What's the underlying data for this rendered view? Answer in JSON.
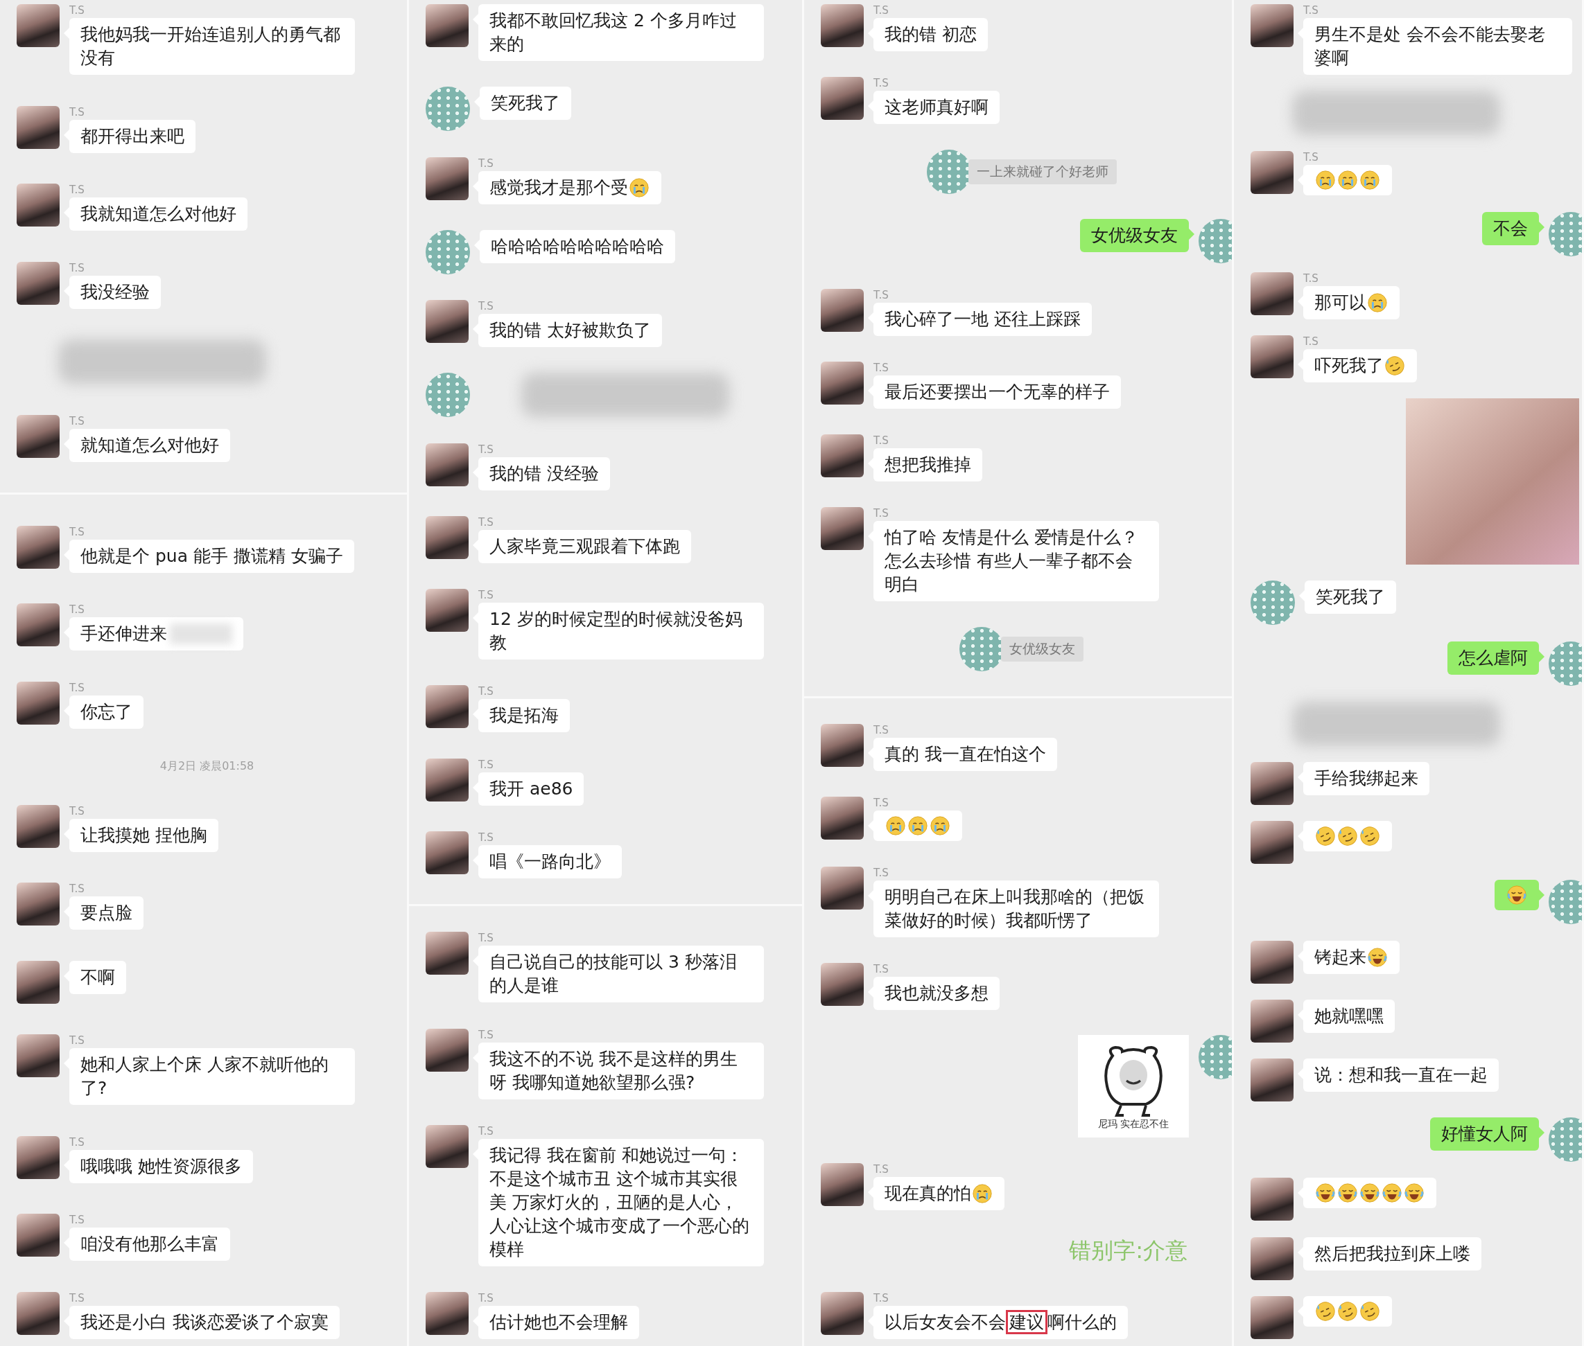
{
  "columns": [
    {
      "messages": [
        {
          "kind": "in",
          "masked_avatar": false,
          "name": "T.S",
          "text": "我他妈我一开始连追别人的勇气都没有"
        },
        {
          "kind": "in",
          "masked_avatar": false,
          "name": "T.S",
          "text": "都开得出来吧"
        },
        {
          "kind": "in",
          "masked_avatar": false,
          "name": "T.S",
          "text": "我就知道怎么对他好"
        },
        {
          "kind": "in",
          "masked_avatar": false,
          "name": "T.S",
          "text": "我没经验"
        },
        {
          "kind": "blur",
          "masked": false
        },
        {
          "kind": "in",
          "masked_avatar": false,
          "name": "T.S",
          "text": "就知道怎么对他好"
        },
        {
          "kind": "divider"
        },
        {
          "kind": "in",
          "masked_avatar": false,
          "name": "T.S",
          "text": "他就是个 pua 能手 撒谎精 女骗子"
        },
        {
          "kind": "in",
          "masked_avatar": false,
          "name": "T.S",
          "text": "手还伸进来",
          "tail_blurred": true
        },
        {
          "kind": "in",
          "masked_avatar": false,
          "name": "T.S",
          "text": "你忘了"
        },
        {
          "kind": "time",
          "text": "4月2日 凌晨01:58"
        },
        {
          "kind": "in",
          "masked_avatar": false,
          "name": "T.S",
          "text": "让我摸她 捏他胸"
        },
        {
          "kind": "in",
          "masked_avatar": false,
          "name": "T.S",
          "text": "要点脸"
        },
        {
          "kind": "in",
          "masked_avatar": false,
          "text": "不啊"
        },
        {
          "kind": "in",
          "masked_avatar": false,
          "name": "T.S",
          "text": "她和人家上个床 人家不就听他的了?"
        },
        {
          "kind": "in",
          "masked_avatar": false,
          "name": "T.S",
          "text": "哦哦哦 她性资源很多"
        },
        {
          "kind": "in",
          "masked_avatar": false,
          "name": "T.S",
          "text": "咱没有他那么丰富"
        },
        {
          "kind": "in",
          "masked_avatar": false,
          "name": "T.S",
          "text": "我还是小白 我谈恋爱谈了个寂寞"
        }
      ]
    },
    {
      "messages": [
        {
          "kind": "in",
          "masked_avatar": false,
          "text": "我都不敢回忆我这 2 个多月咋过来的"
        },
        {
          "kind": "in",
          "masked_avatar": true,
          "text": "笑死我了"
        },
        {
          "kind": "in",
          "masked_avatar": false,
          "name": "T.S",
          "text": "感觉我才是那个受",
          "emojis": [
            {
              "kind": "cry"
            }
          ]
        },
        {
          "kind": "in",
          "masked_avatar": true,
          "text": "哈哈哈哈哈哈哈哈哈哈"
        },
        {
          "kind": "in",
          "masked_avatar": false,
          "name": "T.S",
          "text": "我的错 太好被欺负了"
        },
        {
          "kind": "blur",
          "masked": true
        },
        {
          "kind": "in",
          "masked_avatar": false,
          "name": "T.S",
          "text": "我的错 没经验"
        },
        {
          "kind": "in",
          "masked_avatar": false,
          "name": "T.S",
          "text": "人家毕竟三观跟着下体跑"
        },
        {
          "kind": "in",
          "masked_avatar": false,
          "name": "T.S",
          "text": "12 岁的时候定型的时候就没爸妈教"
        },
        {
          "kind": "in",
          "masked_avatar": false,
          "name": "T.S",
          "text": "我是拓海"
        },
        {
          "kind": "in",
          "masked_avatar": false,
          "name": "T.S",
          "text": "我开 ae86"
        },
        {
          "kind": "in",
          "masked_avatar": false,
          "name": "T.S",
          "text": "唱《一路向北》"
        },
        {
          "kind": "divider"
        },
        {
          "kind": "in",
          "masked_avatar": false,
          "name": "T.S",
          "text": "自己说自己的技能可以 3 秒落泪的人是谁"
        },
        {
          "kind": "in",
          "masked_avatar": false,
          "name": "T.S",
          "text": "我这不的不说 我不是这样的男生呀 我哪知道她欲望那么强?"
        },
        {
          "kind": "in",
          "masked_avatar": false,
          "name": "T.S",
          "text": "我记得 我在窗前 和她说过一句：不是这个城市丑 这个城市其实很美 万家灯火的，丑陋的是人心，人心让这个城市变成了一个恶心的模样"
        },
        {
          "kind": "in",
          "masked_avatar": false,
          "name": "T.S",
          "text": "估计她也不会理解"
        }
      ]
    },
    {
      "messages": [
        {
          "kind": "in",
          "masked_avatar": false,
          "name": "T.S",
          "text": "我的错 初恋"
        },
        {
          "kind": "in",
          "masked_avatar": false,
          "name": "T.S",
          "text": "这老师真好啊"
        },
        {
          "kind": "notice",
          "text": "一上来就碰了个好老师"
        },
        {
          "kind": "out",
          "text": "女优级女友"
        },
        {
          "kind": "in",
          "masked_avatar": false,
          "name": "T.S",
          "text": "我心碎了一地 还往上踩踩"
        },
        {
          "kind": "in",
          "masked_avatar": false,
          "name": "T.S",
          "text": "最后还要摆出一个无辜的样子"
        },
        {
          "kind": "in",
          "masked_avatar": false,
          "name": "T.S",
          "text": "想把我推掉"
        },
        {
          "kind": "in",
          "masked_avatar": false,
          "name": "T.S",
          "text": "怕了哈 友情是什么 爱情是什么？怎么去珍惜 有些人一辈子都不会明白"
        },
        {
          "kind": "notice",
          "text": "女优级女友"
        },
        {
          "kind": "divider"
        },
        {
          "kind": "in",
          "masked_avatar": false,
          "name": "T.S",
          "text": "真的 我一直在怕这个"
        },
        {
          "kind": "in",
          "masked_avatar": false,
          "name": "T.S",
          "emojis": [
            {
              "kind": "cry"
            },
            {
              "kind": "cry"
            },
            {
              "kind": "cry"
            }
          ]
        },
        {
          "kind": "in",
          "masked_avatar": false,
          "name": "T.S",
          "text": "明明自己在床上叫我那啥的（把饭菜做好的时候）我都听愣了"
        },
        {
          "kind": "in",
          "masked_avatar": false,
          "name": "T.S",
          "text": "我也就没多想"
        },
        {
          "kind": "sticker",
          "caption": "尼玛 实在忍不住"
        },
        {
          "kind": "in",
          "masked_avatar": false,
          "name": "T.S",
          "text": "现在真的怕",
          "emojis": [
            {
              "kind": "cry"
            }
          ]
        },
        {
          "kind": "annotation",
          "text": "错别字:介意"
        },
        {
          "kind": "in",
          "masked_avatar": false,
          "name": "T.S",
          "parts": [
            {
              "text": "以后女友会不会",
              "boxed": false
            },
            {
              "text": "建议",
              "boxed": true
            },
            {
              "text": "啊什么的",
              "boxed": false
            }
          ]
        }
      ]
    },
    {
      "messages": [
        {
          "kind": "in",
          "masked_avatar": false,
          "name": "T.S",
          "text": "男生不是处 会不会不能去娶老婆啊"
        },
        {
          "kind": "blur",
          "masked": false
        },
        {
          "kind": "in",
          "masked_avatar": false,
          "name": "T.S",
          "emojis": [
            {
              "kind": "cry"
            },
            {
              "kind": "cry"
            },
            {
              "kind": "cry"
            }
          ]
        },
        {
          "kind": "out",
          "text": "不会"
        },
        {
          "kind": "in",
          "masked_avatar": false,
          "name": "T.S",
          "text": "那可以",
          "emojis": [
            {
              "kind": "cry"
            }
          ]
        },
        {
          "kind": "in",
          "masked_avatar": false,
          "name": "T.S",
          "text": "吓死我了",
          "emojis": [
            {
              "kind": "sweat"
            }
          ]
        },
        {
          "kind": "photo"
        },
        {
          "kind": "in",
          "masked_avatar": true,
          "text": "笑死我了"
        },
        {
          "kind": "out",
          "text": "怎么虐阿"
        },
        {
          "kind": "blur",
          "masked": false
        },
        {
          "kind": "in",
          "masked_avatar": false,
          "text": "手给我绑起来"
        },
        {
          "kind": "in",
          "masked_avatar": false,
          "emojis": [
            {
              "kind": "sweat"
            },
            {
              "kind": "sweat"
            },
            {
              "kind": "sweat"
            }
          ]
        },
        {
          "kind": "out",
          "emojis": [
            {
              "kind": "laugh"
            }
          ]
        },
        {
          "kind": "in",
          "masked_avatar": false,
          "text": "铐起来",
          "emojis": [
            {
              "kind": "laugh"
            }
          ]
        },
        {
          "kind": "in",
          "masked_avatar": false,
          "text": "她就嘿嘿"
        },
        {
          "kind": "in",
          "masked_avatar": false,
          "text": "说：想和我一直在一起"
        },
        {
          "kind": "out",
          "text": "好懂女人阿"
        },
        {
          "kind": "in",
          "masked_avatar": false,
          "emojis": [
            {
              "kind": "laugh"
            },
            {
              "kind": "laugh"
            },
            {
              "kind": "laugh"
            },
            {
              "kind": "laugh"
            },
            {
              "kind": "laugh"
            }
          ]
        },
        {
          "kind": "in",
          "masked_avatar": false,
          "text": "然后把我拉到床上喽"
        },
        {
          "kind": "in",
          "masked_avatar": false,
          "emojis": [
            {
              "kind": "sweat"
            },
            {
              "kind": "sweat"
            },
            {
              "kind": "sweat"
            }
          ]
        }
      ]
    }
  ]
}
